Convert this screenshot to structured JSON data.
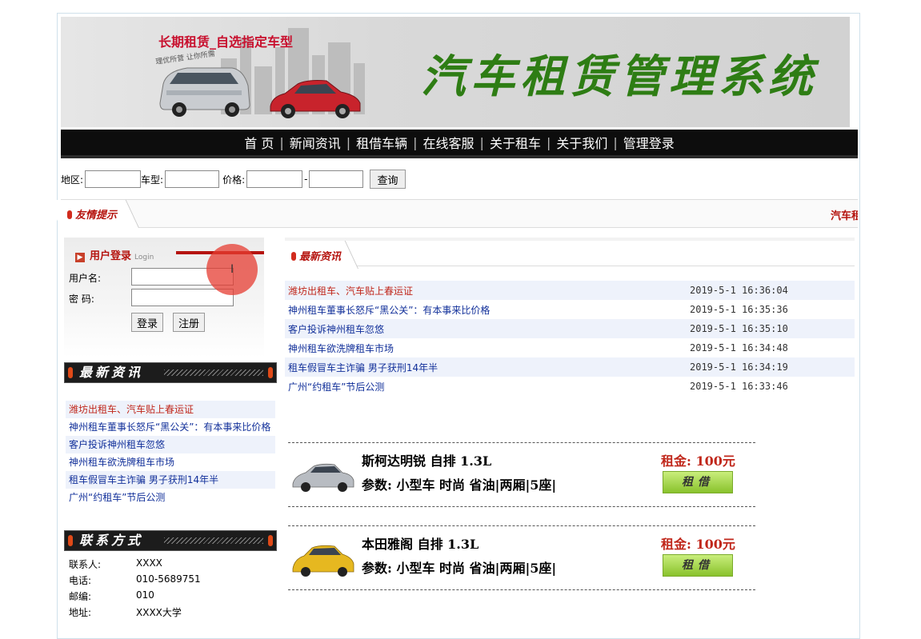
{
  "banner": {
    "slogan": "长期租赁_自选指定车型",
    "slogan_sub": "理优所营 让你所需",
    "title": "汽车租赁管理系统"
  },
  "nav": {
    "items": [
      "首 页",
      "新闻资讯",
      "租借车辆",
      "在线客服",
      "关于租车",
      "关于我们",
      "管理登录"
    ],
    "separator": "|"
  },
  "search": {
    "region_label": "地区:",
    "model_label": "车型:",
    "price_label": "价格:",
    "range_sep": "-",
    "query_button": "查询"
  },
  "notice": {
    "tab_label": "友情提示",
    "marquee_text": "汽车租"
  },
  "login": {
    "title": "用户登录",
    "title_en": "Login",
    "username_label": "用户名:",
    "password_label": "密  码:",
    "login_button": "登录",
    "register_button": "注册"
  },
  "side_news": {
    "title": "最新资讯",
    "items": [
      "潍坊出租车、汽车贴上春运证",
      "神州租车董事长怒斥“黑公关”：有本事来比价格",
      "客户投诉神州租车忽悠",
      "神州租车欲洗牌租车市场",
      "租车假冒车主诈骗 男子获刑14年半",
      "广州“约租车”节后公测"
    ]
  },
  "contact": {
    "title": "联系方式",
    "rows": [
      {
        "k": "联系人:",
        "v": "XXXX"
      },
      {
        "k": "电话:",
        "v": "010-5689751"
      },
      {
        "k": "邮编:",
        "v": "010"
      },
      {
        "k": "地址:",
        "v": "XXXX大学"
      }
    ]
  },
  "main_news": {
    "title": "最新资讯",
    "rows": [
      {
        "title": "潍坊出租车、汽车贴上春运证",
        "date": "2019-5-1 16:36:04"
      },
      {
        "title": "神州租车董事长怒斥“黑公关”：有本事来比价格",
        "date": "2019-5-1 16:35:36"
      },
      {
        "title": "客户投诉神州租车忽悠",
        "date": "2019-5-1 16:35:10"
      },
      {
        "title": "神州租车欲洗牌租车市场",
        "date": "2019-5-1 16:34:48"
      },
      {
        "title": "租车假冒车主诈骗 男子获刑14年半",
        "date": "2019-5-1 16:34:19"
      },
      {
        "title": "广州“约租车”节后公测",
        "date": "2019-5-1 16:33:46"
      }
    ]
  },
  "cars": [
    {
      "name": "斯柯达明锐    自排 1.3L",
      "params": "参数:  小型车 时尚 省油|两厢|5座|",
      "price": "租金:  100元",
      "rent_button": "租借",
      "color": "#b8bcc2"
    },
    {
      "name": "本田雅阁    自排 1.3L",
      "params": "参数:  小型车 时尚 省油|两厢|5座|",
      "price": "租金:  100元",
      "rent_button": "租借",
      "color": "#e6b820"
    }
  ],
  "colors": {
    "accent_red": "#c0271b",
    "link_blue": "#12309a",
    "title_green": "#2e7d14"
  }
}
